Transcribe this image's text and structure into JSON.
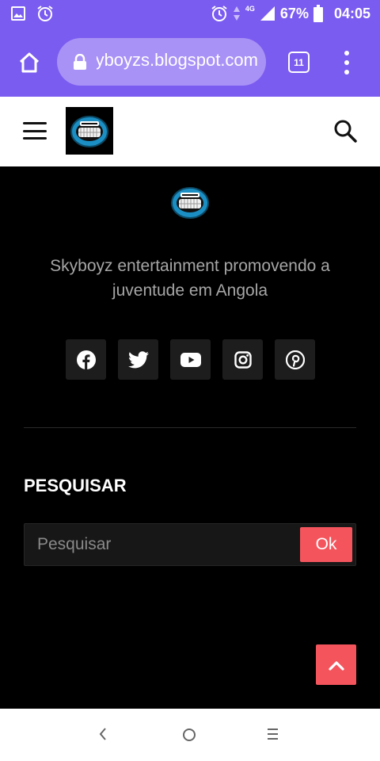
{
  "status_bar": {
    "network": "4G",
    "battery": "67%",
    "time": "04:05",
    "icons": [
      "image-icon",
      "alarm-icon",
      "alarm-icon",
      "data-arrows-icon",
      "signal-icon",
      "battery-icon"
    ]
  },
  "browser": {
    "url": "skyboyzs.blogspot.com",
    "tab_count": "11",
    "icons": [
      "home-icon",
      "lock-icon",
      "tabs-icon",
      "overflow-menu-icon"
    ]
  },
  "header": {
    "icons": [
      "hamburger-menu-icon",
      "site-logo",
      "search-icon"
    ]
  },
  "footer": {
    "about_text": "Skyboyz entertainment promovendo a juventude em Angola",
    "social_links": [
      "facebook",
      "twitter",
      "youtube",
      "instagram",
      "pinterest"
    ],
    "search_widget": {
      "title": "PESQUISAR",
      "placeholder": "Pesquisar",
      "button_label": "Ok"
    }
  },
  "colors": {
    "browser_bar": "#7b5cf0",
    "url_box": "#a992f6",
    "accent": "#f4555d",
    "footer_background": "#000000",
    "social_button": "#1d1d1d"
  }
}
